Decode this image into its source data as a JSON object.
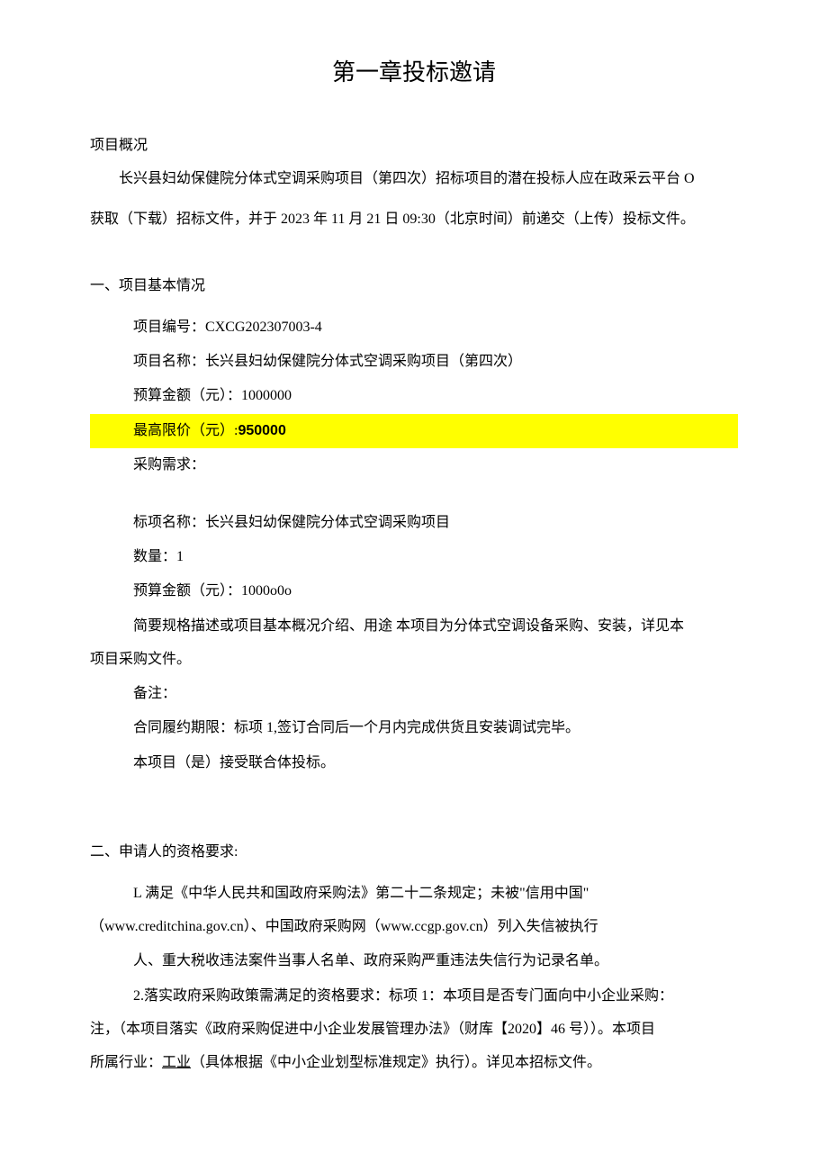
{
  "title": "第一章投标邀请",
  "overview": {
    "heading": "项目概况",
    "para1": "长兴县妇幼保健院分体式空调采购项目（第四次）招标项目的潜在投标人应在政采云平台 O",
    "para2": "获取（下载）招标文件，并于 2023 年 11 月 21 日 09:30（北京时间）前递交（上传）投标文件。"
  },
  "section1": {
    "heading": "一、项目基本情况",
    "project_no_label": "项目编号：",
    "project_no": "CXCG202307003-4",
    "project_name_label": "项目名称：",
    "project_name": "长兴县妇幼保健院分体式空调采购项目（第四次）",
    "budget_label": "预算金额（元）：",
    "budget": "1000000",
    "max_price_label": "最高限价（元）:",
    "max_price": "950000",
    "requirement_label": "采购需求：",
    "lot_name_label": "标项名称：",
    "lot_name": "长兴县妇幼保健院分体式空调采购项目",
    "qty_label": "数量：",
    "qty": "1",
    "budget2_label": "预算金额（元）：",
    "budget2": "1000o0o",
    "spec_line1": "简要规格描述或项目基本概况介绍、用途 本项目为分体式空调设备采购、安装，详见本",
    "spec_line2": "项目采购文件。",
    "remark_label": "备注：",
    "contract_label": "合同履约期限：",
    "contract_text": "标项 1,签订合同后一个月内完成供货且安装调试完毕。",
    "consortium": "本项目（是）接受联合体投标。"
  },
  "section2": {
    "heading": "二、申请人的资格要求:",
    "req1_line1": "L 满足《中华人民共和国政府采购法》第二十二条规定；未被\"信用中国\"",
    "req1_line2": "（www.creditchina.gov.cn）、中国政府采购网（www.ccgp.gov.cn）列入失信被执行",
    "req1_line3": "人、重大税收违法案件当事人名单、政府采购严重违法失信行为记录名单。",
    "req2_line1": "2.落实政府采购政策需满足的资格要求：标项 1：本项目是否专门面向中小企业采购：",
    "req2_line2a": "注，（本项目落实《政府采购促进中小企业发展管理办法》（财库【2020】46 号））。本项目",
    "req2_line3a": "所属行业：",
    "req2_industry": "工业",
    "req2_line3b": "（具体根据《中小企业划型标准规定》执行）。详见本招标文件。"
  }
}
